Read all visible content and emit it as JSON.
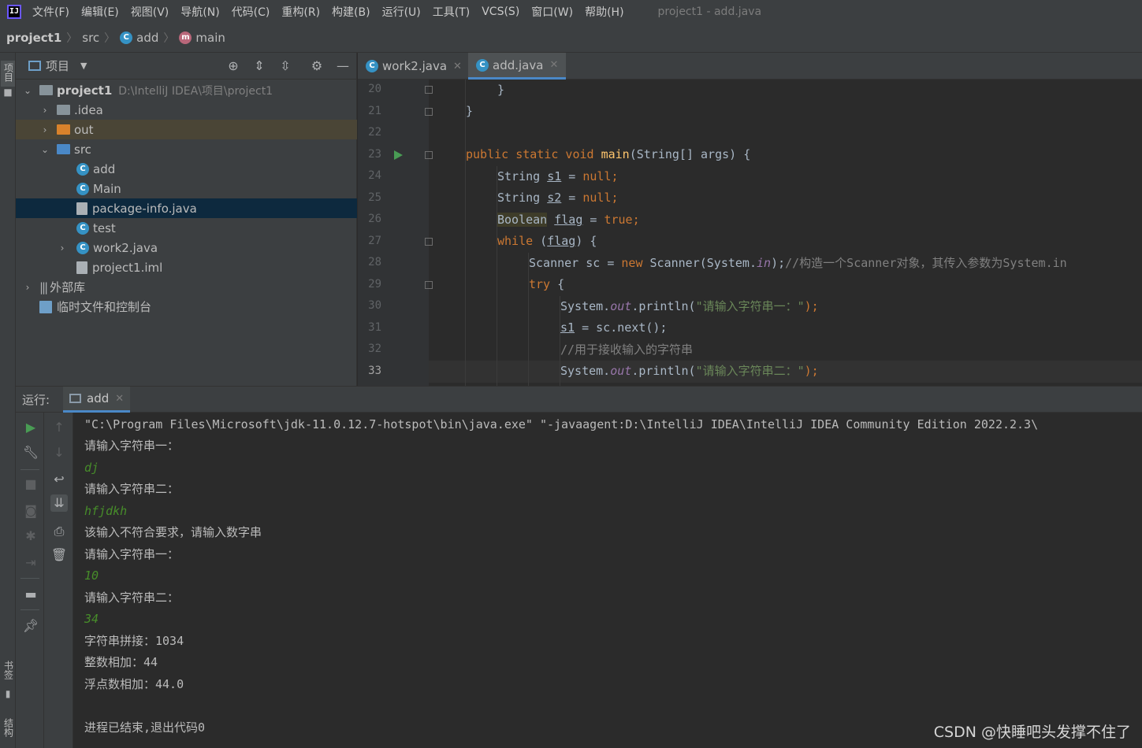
{
  "menubar": {
    "logo": "IJ",
    "items": [
      "文件(F)",
      "编辑(E)",
      "视图(V)",
      "导航(N)",
      "代码(C)",
      "重构(R)",
      "构建(B)",
      "运行(U)",
      "工具(T)",
      "VCS(S)",
      "窗口(W)",
      "帮助(H)"
    ],
    "window_title": "project1 - add.java"
  },
  "breadcrumb": {
    "project": "project1",
    "folder": "src",
    "class": "add",
    "method": "main"
  },
  "left_stripe": {
    "project_tab": "项目",
    "bookmarks_tab": "书签",
    "structure_tab": "结构"
  },
  "project_panel": {
    "title": "项目",
    "tree": [
      {
        "label": "project1",
        "path": "D:\\IntelliJ IDEA\\项目\\project1"
      },
      {
        "label": ".idea"
      },
      {
        "label": "out"
      },
      {
        "label": "src"
      },
      {
        "label": "add"
      },
      {
        "label": "Main"
      },
      {
        "label": "package-info.java"
      },
      {
        "label": "test"
      },
      {
        "label": "work2.java"
      },
      {
        "label": "project1.iml"
      },
      {
        "label": "外部库"
      },
      {
        "label": "临时文件和控制台"
      }
    ]
  },
  "tabs": [
    {
      "label": "work2.java"
    },
    {
      "label": "add.java"
    }
  ],
  "editor": {
    "line_numbers": [
      "20",
      "21",
      "22",
      "23",
      "24",
      "25",
      "26",
      "27",
      "28",
      "29",
      "30",
      "31",
      "32",
      "33"
    ],
    "code": {
      "l20": "}",
      "l21": "}",
      "l23_kw": "public static void ",
      "l23_fn": "main",
      "l23_rest": "(String[] args) {",
      "l24_a": "String ",
      "l24_var": "s1",
      "l24_b": " = ",
      "l24_kw": "null",
      "l24_c": ";",
      "l25_a": "String ",
      "l25_var": "s2",
      "l25_b": " = ",
      "l25_kw": "null",
      "l25_c": ";",
      "l26_type": "Boolean",
      "l26_sp": " ",
      "l26_var": "flag",
      "l26_b": " = ",
      "l26_kw": "true",
      "l26_c": ";",
      "l27_kw": "while",
      "l27_a": " (",
      "l27_var": "flag",
      "l27_b": ") {",
      "l28_a": "Scanner sc = ",
      "l28_kw": "new ",
      "l28_b": "Scanner(System.",
      "l28_fld": "in",
      "l28_c": ");",
      "l28_cmt": "//构造一个Scanner对象，其传入参数为System.in",
      "l29_kw": "try",
      "l29_a": " {",
      "l30_a": "System.",
      "l30_fld": "out",
      "l30_b": ".println(",
      "l30_str": "\"请输入字符串一：\"",
      "l30_c": ");",
      "l31_var": "s1",
      "l31_a": " = sc.next();",
      "l32_cmt": "//用于接收输入的字符串",
      "l33_a": "System.",
      "l33_fld": "out",
      "l33_b": ".println(",
      "l33_str": "\"请输入字符串二：\"",
      "l33_c": ");"
    }
  },
  "run_panel": {
    "label": "运行:",
    "tab": "add",
    "console": [
      "\"C:\\Program Files\\Microsoft\\jdk-11.0.12.7-hotspot\\bin\\java.exe\" \"-javaagent:D:\\IntelliJ IDEA\\IntelliJ IDEA Community Edition 2022.2.3\\",
      "请输入字符串一：",
      "dj",
      "请输入字符串二：",
      "hfjdkh",
      "该输入不符合要求，请输入数字串",
      "请输入字符串一：",
      "10",
      "请输入字符串二：",
      "34",
      "字符串拼接：1034",
      "整数相加：44",
      "浮点数相加：44.0",
      "",
      "进程已结束,退出代码0"
    ]
  },
  "watermark": "CSDN @快睡吧头发撑不住了",
  "colors": {
    "keyword": "#cc7832",
    "function": "#ffc66d",
    "string": "#6a8759",
    "comment": "#808080",
    "field": "#9876aa",
    "console_input": "#478d2a",
    "selection": "#0d293e",
    "accent": "#4a88c7"
  }
}
